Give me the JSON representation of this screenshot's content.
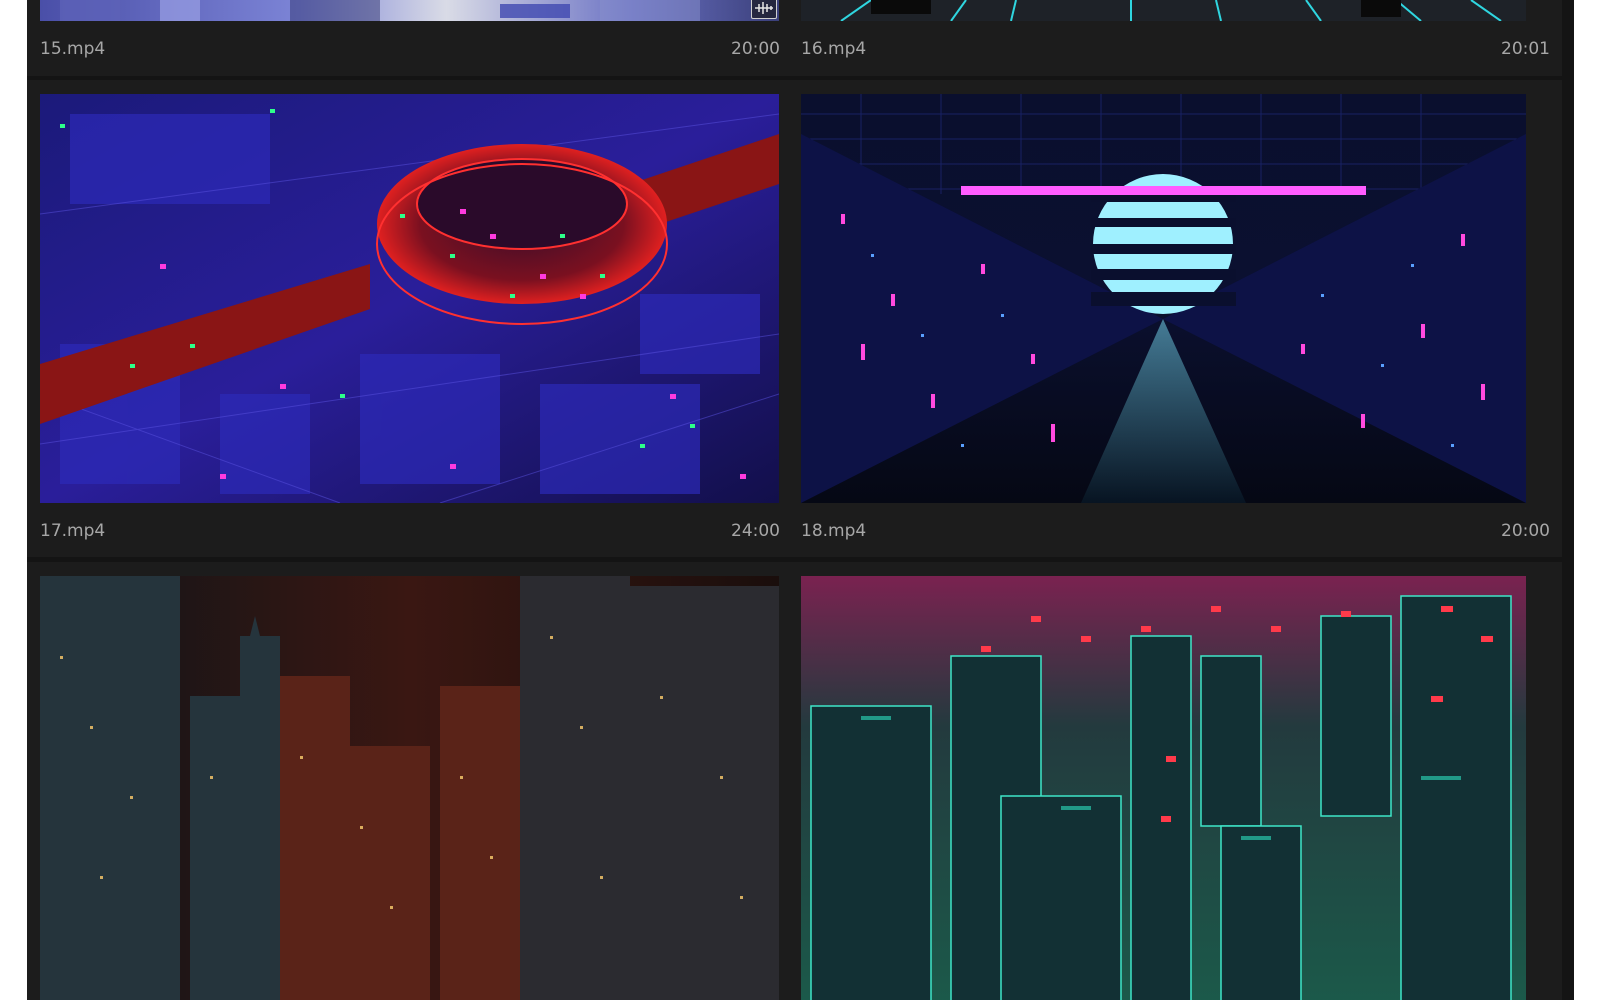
{
  "clips": [
    {
      "name": "15.mp4",
      "duration": "20:00",
      "icon": "audio-waveform-icon"
    },
    {
      "name": "16.mp4",
      "duration": "20:01"
    },
    {
      "name": "17.mp4",
      "duration": "24:00"
    },
    {
      "name": "18.mp4",
      "duration": "20:00"
    },
    {
      "name": "",
      "duration": ""
    },
    {
      "name": "",
      "duration": ""
    }
  ],
  "colors": {
    "panel_bg": "#141414",
    "card_bg": "#1c1c1c",
    "meta_text": "#a7a7a7"
  }
}
